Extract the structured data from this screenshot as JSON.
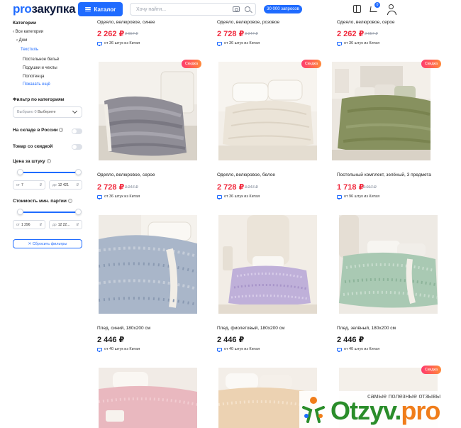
{
  "header": {
    "logo_pro": "pro",
    "logo_rest": "закупка",
    "catalog_label": "Каталог",
    "search_placeholder": "Хочу найти...",
    "requests_badge": "30 000 запросов",
    "cart_count": "0"
  },
  "sidebar": {
    "categories_title": "Категории",
    "all_categories": "Все категории",
    "home": "Дом",
    "textile": "Текстиль",
    "subcategories": [
      "Постельное бельё",
      "Подушки и чехлы",
      "Полотенца"
    ],
    "show_more": "Показать ещё",
    "filter_title": "Фильтр по категориям",
    "filter_select_prefix": "Выбрано 0",
    "filter_select_value": "Выберите",
    "in_stock_label": "На складе в России",
    "discount_label": "Товар со скидкой",
    "price_title": "Цена за штуку",
    "price_from_label": "от",
    "price_from": "7",
    "price_to_label": "до",
    "price_to": "12 421",
    "cost_title": "Стоимость мин. партии",
    "cost_from_label": "от",
    "cost_from": "1 296",
    "cost_to_label": "до",
    "cost_to": "12 22...",
    "currency": "₽",
    "reset_label": "Сбросить фильтры"
  },
  "sale_badge": "Скидка",
  "rows": [
    {
      "products": [
        {
          "name": "Одеяло, велюровое, синее",
          "price": "2 262 ₽",
          "old": "2 657 ₽",
          "sale": true,
          "ship": "от 36 штук из Китая"
        },
        {
          "name": "Одеяло, велюровое, розовое",
          "price": "2 728 ₽",
          "old": "3 247 ₽",
          "sale": true,
          "ship": "от 36 штук из Китая"
        },
        {
          "name": "Одеяло, велюровое, серое",
          "price": "2 262 ₽",
          "old": "2 657 ₽",
          "sale": true,
          "ship": "от 36 штук из Китая"
        }
      ]
    },
    {
      "products": [
        {
          "name": "Одеяло, велюровое, серое",
          "price": "2 728 ₽",
          "old": "3 247 ₽",
          "sale": true,
          "ship": "от 36 штук из Китая"
        },
        {
          "name": "Одеяло, велюровое, белое",
          "price": "2 728 ₽",
          "old": "3 247 ₽",
          "sale": true,
          "ship": "от 36 штук из Китая"
        },
        {
          "name": "Постельный комплект, зелёный, 3 предмета",
          "price": "1 718 ₽",
          "old": "2 017 ₽",
          "sale": true,
          "ship": "от 96 штук из Китая"
        }
      ]
    },
    {
      "products": [
        {
          "name": "Плед, синий, 180х200 см",
          "price": "2 446 ₽",
          "old": "",
          "sale": false,
          "ship": "от 40 штук из Китая"
        },
        {
          "name": "Плед, фиолетовый, 180х200 см",
          "price": "2 446 ₽",
          "old": "",
          "sale": false,
          "ship": "от 40 штук из Китая"
        },
        {
          "name": "Плед, зелёный, 180х200 см",
          "price": "2 446 ₽",
          "old": "",
          "sale": false,
          "ship": "от 40 штук из Китая"
        }
      ]
    }
  ],
  "watermark": {
    "tagline": "самые полезные отзывы",
    "logo_main": "Otzyv.",
    "logo_pro": "pro"
  },
  "colors": {
    "accent": "#1f6bff",
    "sale_price": "#f0283c"
  }
}
